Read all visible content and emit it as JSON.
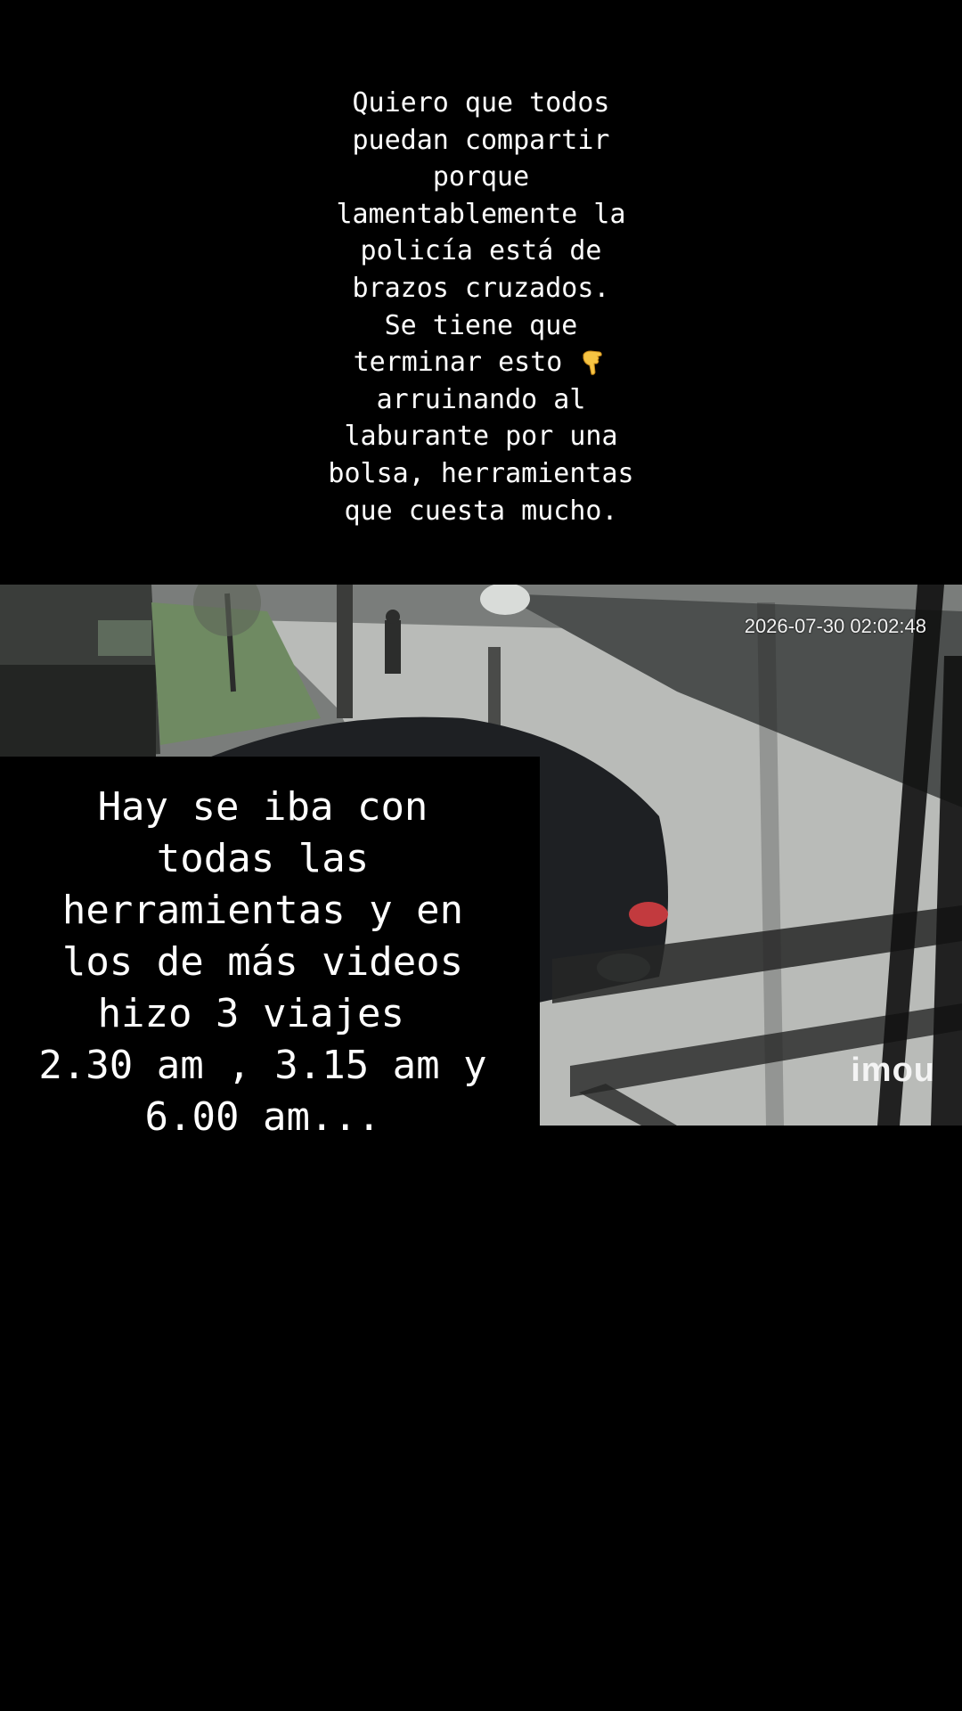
{
  "top_caption": {
    "lines": [
      "Quiero que todos",
      "puedan compartir",
      "porque",
      "lamentablemente la",
      "policía está de",
      "brazos cruzados.",
      "Se tiene que",
      "terminar esto",
      "arruinando al",
      "laburante por una",
      "bolsa, herramientas",
      "que cuesta mucho."
    ],
    "emoji_icon": "pointing-down-hand-icon"
  },
  "video": {
    "timestamp": "2026-07-30 02:02:48",
    "brand": "imou"
  },
  "bottom_caption": {
    "lines": [
      "Hay se iba con",
      "todas las",
      "herramientas y en",
      "los de más videos",
      "hizo 3 viajes ",
      "2.30 am , 3.15 am y",
      "6.00 am..."
    ]
  }
}
